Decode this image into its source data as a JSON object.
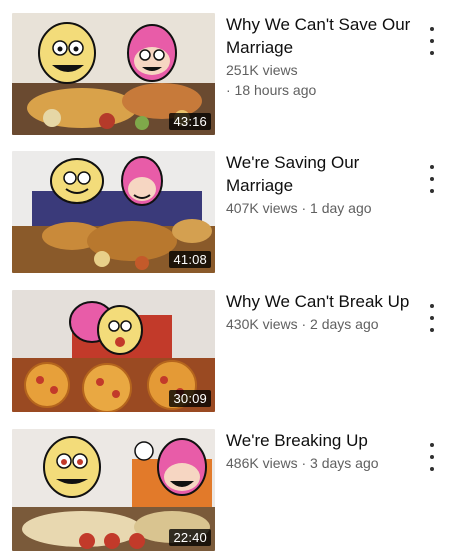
{
  "videos": [
    {
      "title": "Why We Can't Save Our Marriage",
      "views": "251K views",
      "age": "· 18 hours ago",
      "duration": "43:16"
    },
    {
      "title": "We're Saving Our Marriage",
      "views": "407K views",
      "age": "· 1 day ago",
      "duration": "41:08"
    },
    {
      "title": "Why We Can't Break Up",
      "views": "430K views",
      "age": "· 2 days ago",
      "duration": "30:09"
    },
    {
      "title": "We're Breaking Up",
      "views": "486K views",
      "age": "· 3 days ago",
      "duration": "22:40"
    }
  ],
  "icons": {
    "more": "more-vert-icon"
  },
  "colors": {
    "title": "#0f0f0f",
    "meta": "#606060",
    "duration_bg": "#000000"
  }
}
